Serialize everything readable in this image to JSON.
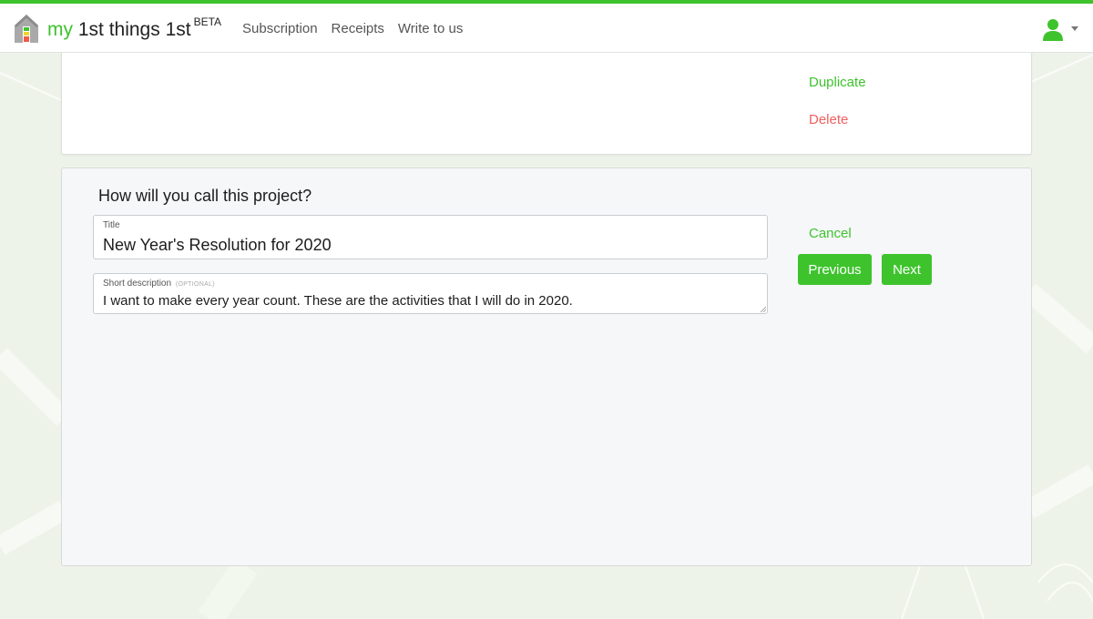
{
  "brand": {
    "my": "my",
    "name": "1st things 1st",
    "tag": "BETA"
  },
  "nav": {
    "links": [
      "Subscription",
      "Receipts",
      "Write to us"
    ]
  },
  "user_menu": {
    "icon": "user-icon"
  },
  "top_card": {
    "duplicate_label": "Duplicate",
    "delete_label": "Delete"
  },
  "project_form": {
    "question": "How will you call this project?",
    "title_label": "Title",
    "title_value": "New Year's Resolution for 2020",
    "description_label": "Short description",
    "description_optional": "(OPTIONAL)",
    "description_value": "I want to make every year count. These are the activities that I will do in 2020.",
    "cancel_label": "Cancel",
    "previous_label": "Previous",
    "next_label": "Next"
  },
  "colors": {
    "accent": "#3ec32d",
    "danger": "#f06060",
    "form_bg": "#f6f7f9"
  }
}
